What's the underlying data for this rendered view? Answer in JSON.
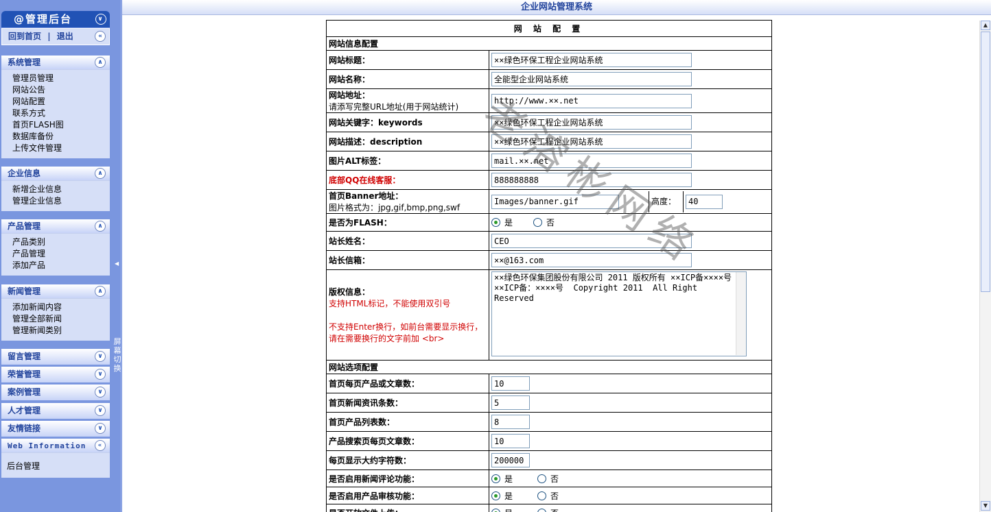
{
  "sidebar": {
    "logo": "@管理后台",
    "home": "回到首页",
    "sep": "|",
    "logout": "退出",
    "groups": [
      {
        "title": "系统管理",
        "items": [
          "管理员管理",
          "网站公告",
          "网站配置",
          "联系方式",
          "首页FLASH图",
          "数据库备份",
          "上传文件管理"
        ]
      },
      {
        "title": "企业信息",
        "items": [
          "新增企业信息",
          "管理企业信息"
        ]
      },
      {
        "title": "产品管理",
        "items": [
          "产品类别",
          "产品管理",
          "添加产品"
        ]
      },
      {
        "title": "新闻管理",
        "items": [
          "添加新闻内容",
          "管理全部新闻",
          "管理新闻类别"
        ]
      }
    ],
    "collapsed": [
      "留言管理",
      "荣誉管理",
      "案例管理",
      "人才管理",
      "友情链接"
    ],
    "web_info": {
      "title": "Web Information",
      "sub": "后台管理"
    },
    "switch_label": "屏幕切换"
  },
  "header": {
    "title": "企业网站管理系统"
  },
  "form": {
    "caption": "网 站 配 置",
    "section1": "网站信息配置",
    "site_title": {
      "label": "网站标题：",
      "value": "××绿色环保工程企业网站系统"
    },
    "site_name": {
      "label": "网站名称：",
      "value": "全能型企业网站系统"
    },
    "site_url": {
      "label": "网站地址：",
      "hint": "请添写完整URL地址(用于网站统计)",
      "value": "http://www.××.net"
    },
    "keywords": {
      "label": "网站关键字：keywords",
      "value": "××绿色环保工程企业网站系统"
    },
    "description": {
      "label": "网站描述：description",
      "value": "××绿色环保工程企业网站系统"
    },
    "img_alt": {
      "label": "图片ALT标签：",
      "value": "mail.××.net"
    },
    "qq": {
      "label": "底部QQ在线客服：",
      "value": "888888888"
    },
    "banner": {
      "label": "首页Banner地址：",
      "hint": "图片格式为：jpg,gif,bmp,png,swf",
      "value": "Images/banner.gif",
      "height_label": "高度：",
      "height_value": "40"
    },
    "is_flash": {
      "label": "是否为FLASH：",
      "yes": "是",
      "no": "否"
    },
    "owner_name": {
      "label": "站长姓名：",
      "value": "CEO"
    },
    "owner_mail": {
      "label": "站长信箱：",
      "value": "××@163.com"
    },
    "copyright": {
      "label": "版权信息：",
      "hint1": "支持HTML标记，不能使用双引号",
      "hint2": "不支持Enter换行，如前台需要显示换行，请在需要换行的文字前加 <br>",
      "value": "××绿色环保集团股份有限公司 2011 版权所有 ××ICP备××××号 ××ICP备：××××号  Copyright 2011  All Right Reserved"
    },
    "section2": "网站选项配置",
    "opts": [
      {
        "label": "首页每页产品或文章数：",
        "value": "10"
      },
      {
        "label": "首页新闻资讯条数：",
        "value": "5"
      },
      {
        "label": "首页产品列表数：",
        "value": "8"
      },
      {
        "label": "产品搜索页每页文章数：",
        "value": "10"
      },
      {
        "label": "每页显示大约字符数：",
        "value": "200000"
      }
    ],
    "radios": [
      {
        "label": "是否启用新闻评论功能：",
        "yes": "是",
        "no": "否"
      },
      {
        "label": "是否启用产品审核功能：",
        "yes": "是",
        "no": "否"
      },
      {
        "label": "是否开放文件上传：",
        "yes": "是",
        "no": "否"
      }
    ]
  },
  "watermark": "老溶彬网络"
}
